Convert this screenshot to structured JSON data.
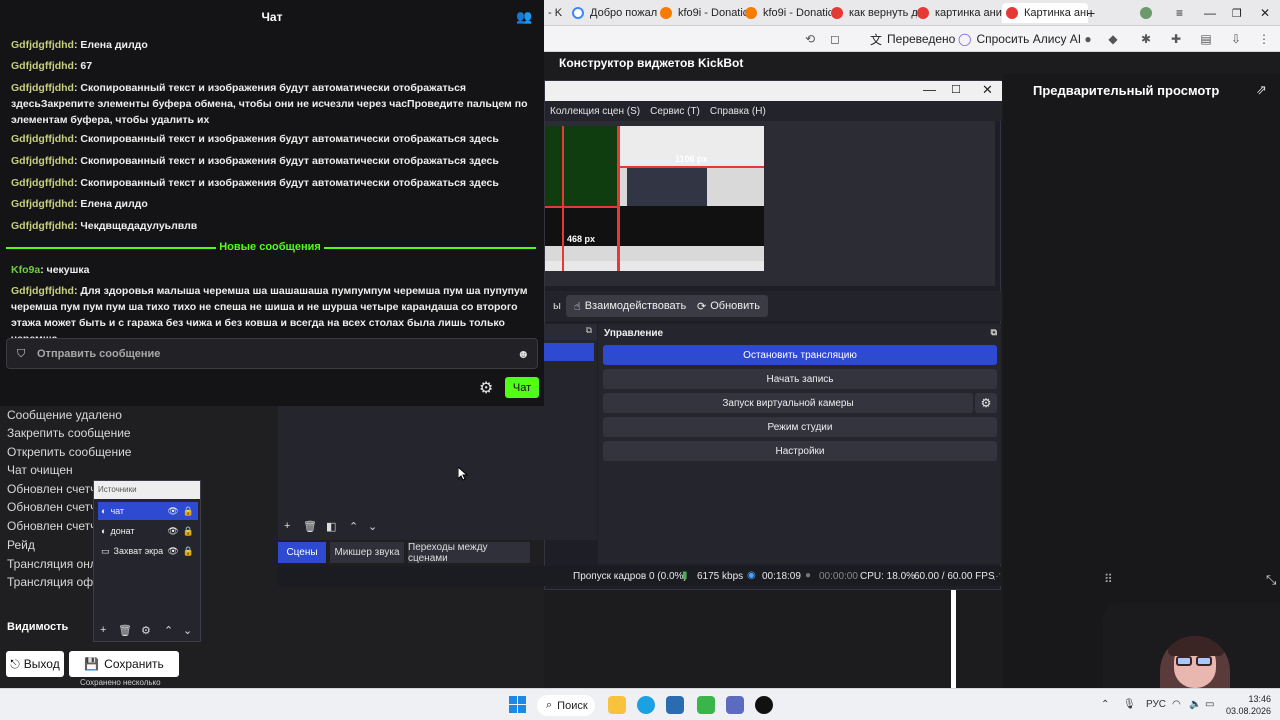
{
  "browser": {
    "tabs": [
      {
        "label": "- K",
        "favicon_color": "#999999"
      },
      {
        "label": "Добро пожал",
        "favicon_color": "#4285f4"
      },
      {
        "label": "kfo9i - Donatic",
        "favicon_color": "#f57c00"
      },
      {
        "label": "kfo9i - Donatic",
        "favicon_color": "#f57c00"
      },
      {
        "label": "как вернуть д",
        "favicon_color": "#e53935"
      },
      {
        "label": "картинка ани",
        "favicon_color": "#e53935"
      },
      {
        "label": "Картинка ани",
        "favicon_color": "#e53935"
      }
    ],
    "new_tab": "+",
    "translated_label": "Переведено",
    "alice_label": "Спросить Алису AI"
  },
  "page": {
    "kick_title": "Конструктор виджетов KickBot",
    "preview_title": "Предварительный просмотр"
  },
  "chat": {
    "title": "Чат",
    "messages": [
      {
        "user": "Gdfjdgffjdhd",
        "text": "Елена дилдо"
      },
      {
        "user": "Gdfjdgffjdhd",
        "text": "67"
      },
      {
        "user": "Gdfjdgffjdhd",
        "text": "Скопированный текст и изображения будут автоматически отображаться здесьЗакрепите элементы буфера обмена, чтобы они не исчезли через часПроведите пальцем по элементам буфера, чтобы удалить их"
      },
      {
        "user": "Gdfjdgffjdhd",
        "text": "Скопированный текст и изображения будут автоматически отображаться здесь"
      },
      {
        "user": "Gdfjdgffjdhd",
        "text": "Скопированный текст и изображения будут автоматически отображаться здесь"
      },
      {
        "user": "Gdfjdgffjdhd",
        "text": "Скопированный текст и изображения будут автоматически отображаться здесь"
      },
      {
        "user": "Gdfjdgffjdhd",
        "text": "Елена дилдо"
      },
      {
        "user": "Gdfjdgffjdhd",
        "text": "Чекдвщвдадулуьлвлв"
      }
    ],
    "new_messages_label": "Новые сообщения",
    "new_messages": [
      {
        "user": "Kfo9a",
        "text": "чекушка"
      },
      {
        "user": "Gdfjdgffjdhd",
        "text": "Для здоровья малыша черемша ша шашашаша пумпумпум черемша пум ша пупупум черемша пум пум пум ша тихо тихо не спеша не шиша и не шурша четыре карандаша со второго этажа может быть и с гаража без чижа и без ковша и всегда на всех столах была лишь только черемша"
      }
    ],
    "input_placeholder": "Отправить сообщение",
    "send_label": "Чат"
  },
  "obs": {
    "menu": [
      "Коллекция сцен (S)",
      "Сервис (T)",
      "Справка (H)"
    ],
    "preview_labels": {
      "width": "1106 px",
      "height": "468 px"
    },
    "toolbar": {
      "tail": "ы",
      "interact": "Взаимодействовать",
      "refresh": "Обновить"
    },
    "control_title": "Управление",
    "controls": {
      "stop_stream": "Остановить трансляцию",
      "start_record": "Начать запись",
      "virtual_cam": "Запуск виртуальной камеры",
      "studio_mode": "Режим студии",
      "settings": "Настройки"
    },
    "bottom_tabs": [
      "Сцены",
      "Микшер звука",
      "Переходы между сценами"
    ],
    "status": {
      "frames": "Пропуск кадров 0 (0.0%)",
      "bitrate": "6175 kbps",
      "time_live": "00:18:09",
      "time_rec": "00:00:00",
      "cpu": "CPU: 18.0%",
      "fps": "60.00 / 60.00 FPS"
    }
  },
  "left_list": {
    "items": [
      "Сообщение удалено",
      "Закрепить сообщение",
      "Открепить сообщение",
      "Чат очищен",
      "Обновлен счетч",
      "Обновлен счетч",
      "Обновлен счетч",
      "Рейд",
      "Трансляция онла",
      "Трансляция офла"
    ],
    "visibility_label": "Видимость",
    "exit_label": "Выход",
    "save_label": "Сохранить",
    "saved_note": "Сохранено несколько"
  },
  "sources": {
    "title": "Источники",
    "items": [
      {
        "label": "чат",
        "selected": true
      },
      {
        "label": "донат",
        "selected": false
      },
      {
        "label": "Захват экра",
        "selected": false
      }
    ]
  },
  "taskbar": {
    "search_label": "Поиск",
    "lang": "РУС",
    "time": "13:46",
    "date": "03.08.2026"
  },
  "colors": {
    "kick_green": "#53fc18",
    "obs_blue": "#2e4ad1",
    "chat_bg": "#141416"
  }
}
